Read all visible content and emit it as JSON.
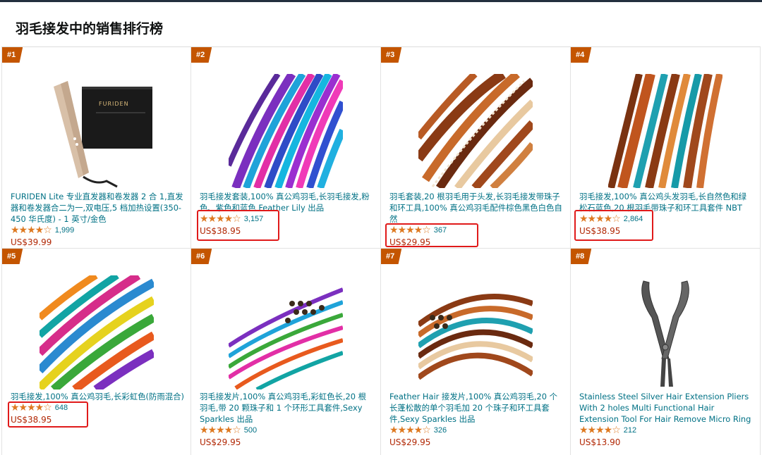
{
  "page": {
    "title": "羽毛接发中的销售排行榜"
  },
  "products": [
    {
      "rank": "#1",
      "title": "FURIDEN Lite 专业直发器和卷发器 2 合 1,直发器和卷发器合二为一,双电压,5 档加热设置(350-450 华氏度) - 1 英寸/金色",
      "rating_stars": "★★★★☆",
      "rating_value": 4.5,
      "reviews": "1,999",
      "price": "US$39.99",
      "highlighted": false,
      "image": "flat-iron"
    },
    {
      "rank": "#2",
      "title": "羽毛接发套装,100% 真公鸡羽毛,长羽毛接发,粉色、紫色和蓝色 Feather Lily 出品",
      "rating_stars": "★★★★☆",
      "rating_value": 4.0,
      "reviews": "3,157",
      "price": "US$38.95",
      "highlighted": true,
      "image": "feathers-blue-pink"
    },
    {
      "rank": "#3",
      "title": "羽毛套装,20 根羽毛用于头发,长羽毛接发带珠子和环工具,100% 真公鸡羽毛配件棕色黑色白色自然",
      "rating_stars": "★★★★☆",
      "rating_value": 4.5,
      "reviews": "367",
      "price": "US$29.95",
      "highlighted": true,
      "image": "feathers-brown"
    },
    {
      "rank": "#4",
      "title": "羽毛接发,100% 真公鸡头发羽毛,长自然色和绿松石蓝色,20 根羽毛带珠子和环工具套件 NBT",
      "rating_stars": "★★★★☆",
      "rating_value": 4.0,
      "reviews": "2,864",
      "price": "US$38.95",
      "highlighted": true,
      "image": "feathers-orange-teal"
    },
    {
      "rank": "#5",
      "title": "羽毛接发,100% 真公鸡羽毛,长彩虹色(防雨混合)",
      "rating_stars": "★★★★☆",
      "rating_value": 4.5,
      "reviews": "648",
      "price": "US$38.95",
      "highlighted": true,
      "image": "feathers-rainbow"
    },
    {
      "rank": "#6",
      "title": "羽毛接发片,100% 真公鸡羽毛,彩虹色长,20 根羽毛,带 20 颗珠子和 1 个环形工具套件,Sexy Sparkles 出品",
      "rating_stars": "★★★★☆",
      "rating_value": 4.0,
      "reviews": "500",
      "price": "US$29.95",
      "highlighted": false,
      "image": "feathers-beads-rainbow"
    },
    {
      "rank": "#7",
      "title": "Feather Hair 接发片,100% 真公鸡羽毛,20 个长蓬松散的单个羽毛加 20 个珠子和环工具套件,Sexy Sparkles 出品",
      "rating_stars": "★★★★☆",
      "rating_value": 4.5,
      "reviews": "326",
      "price": "US$29.95",
      "highlighted": false,
      "image": "feathers-beads-natural"
    },
    {
      "rank": "#8",
      "title": "Stainless Steel Silver Hair Extension Pliers With 2 holes Multi Functional Hair Extension Tool For Hair Remove Micro Ring Loop",
      "rating_stars": "★★★★☆",
      "rating_value": 4.0,
      "reviews": "212",
      "price": "US$13.90",
      "highlighted": false,
      "image": "pliers"
    }
  ],
  "colors": {
    "accent": "#c45500",
    "link": "#007185",
    "price": "#b12704",
    "star": "#de7921",
    "highlight": "#e01a1a"
  }
}
